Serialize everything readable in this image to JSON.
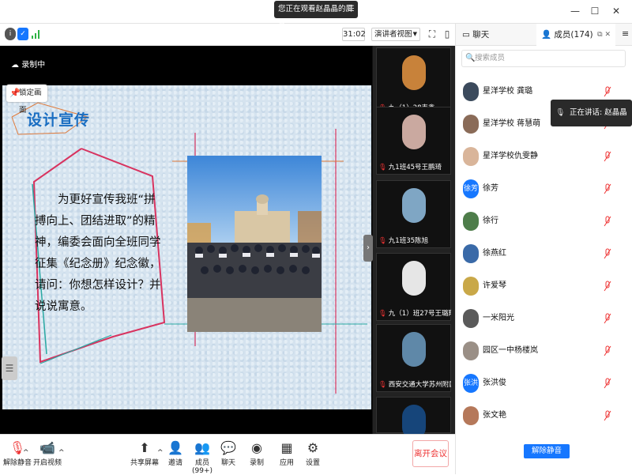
{
  "window": {
    "sharing_notice": "您正在观看赵晶晶的屏幕",
    "menu_glyph": "☰",
    "minimize": "—",
    "maximize": "☐",
    "close": "✕"
  },
  "toolbar": {
    "timer": "31:02",
    "view_mode": "演讲者视图",
    "icons": [
      "info-icon",
      "shield-icon",
      "signal-icon",
      "fullscreen-icon",
      "layout-icon"
    ]
  },
  "right_tabs": {
    "chat": "聊天",
    "members": "成员(174)"
  },
  "screen": {
    "recording": "录制中",
    "lock_screen": "锁定画面"
  },
  "slide": {
    "title": "设计宣传",
    "body": "为更好宣传我班“拼搏向上、团结进取”的精神，编委会面向全班同学征集《纪念册》纪念徽，请问：你想怎样设计？并说说寓意。"
  },
  "video_tiles": [
    {
      "name": "九（1）28韦鑫",
      "avatar_color": "#c8823a"
    },
    {
      "name": "九1班45号王鹏琦",
      "avatar_color": "#caa9a0"
    },
    {
      "name": "九1班35陈旭",
      "avatar_color": "#7fa6c4"
    },
    {
      "name": "九（1）班27号王璐翔",
      "avatar_color": "#e6e6e6"
    },
    {
      "name": "西安交通大学苏州附属初...",
      "avatar_color": "#5f88a8"
    },
    {
      "name": "",
      "avatar_color": "#16457a"
    }
  ],
  "bottom_bar": {
    "unmute": "解除静音",
    "start_video": "开启视频",
    "share_screen": "共享屏幕",
    "invite": "邀请",
    "members": "成员(99+)",
    "chat": "聊天",
    "record": "录制",
    "apps": "应用",
    "settings": "设置",
    "leave": "离开会议"
  },
  "members": {
    "search_placeholder": "搜索成员",
    "speaking": "正在讲话: 赵晶晶",
    "list": [
      {
        "name": "星洋学校 龚璐",
        "avatar_color": "#3b4a5c",
        "initial": ""
      },
      {
        "name": "星洋学校 蒋慧萌",
        "avatar_color": "#8a6b58",
        "initial": ""
      },
      {
        "name": "星洋学校仇雯静",
        "avatar_color": "#d9b59a",
        "initial": ""
      },
      {
        "name": "徐芳",
        "avatar_color": "#1677ff",
        "initial": "徐芳"
      },
      {
        "name": "徐行",
        "avatar_color": "#4e7d4a",
        "initial": ""
      },
      {
        "name": "徐燕红",
        "avatar_color": "#3a6aa8",
        "initial": ""
      },
      {
        "name": "许爱琴",
        "avatar_color": "#c9a848",
        "initial": ""
      },
      {
        "name": "一米阳光",
        "avatar_color": "#5a5a5a",
        "initial": ""
      },
      {
        "name": "园区一中杨楼岚",
        "avatar_color": "#9a8f86",
        "initial": ""
      },
      {
        "name": "张洪俊",
        "avatar_color": "#1677ff",
        "initial": "张洪"
      },
      {
        "name": "张文艳",
        "avatar_color": "#b5785a",
        "initial": ""
      }
    ],
    "unmute_all": "解除静音"
  }
}
